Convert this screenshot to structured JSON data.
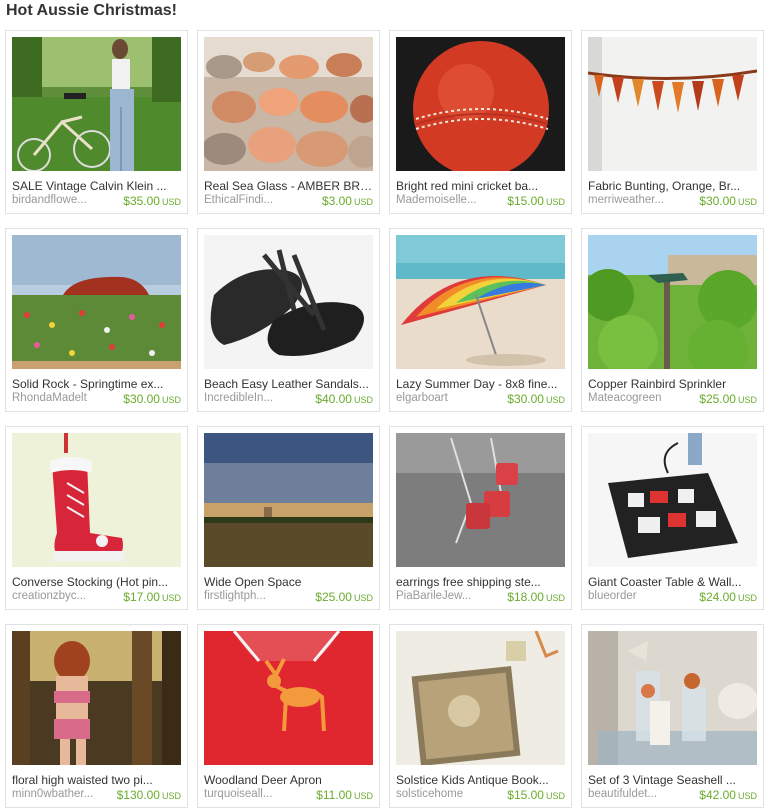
{
  "page": {
    "title": "Hot Aussie Christmas!"
  },
  "items": [
    {
      "title": "SALE Vintage Calvin Klein ...",
      "shop": "birdandflowe...",
      "price": "$35.00",
      "currency": "USD",
      "image": "vintage-jeans-bicycle-photo"
    },
    {
      "title": "Real Sea Glass - AMBER BRO...",
      "shop": "EthicalFindi...",
      "price": "$3.00",
      "currency": "USD",
      "image": "sea-glass-photo"
    },
    {
      "title": "Bright red mini cricket ba...",
      "shop": "Mademoiselle...",
      "price": "$15.00",
      "currency": "USD",
      "image": "cricket-ball-photo"
    },
    {
      "title": "Fabric Bunting, Orange, Br...",
      "shop": "merriweather...",
      "price": "$30.00",
      "currency": "USD",
      "image": "bunting-photo"
    },
    {
      "title": "Solid Rock - Springtime ex...",
      "shop": "RhondaMadelt",
      "price": "$30.00",
      "currency": "USD",
      "image": "uluru-painting"
    },
    {
      "title": "Beach Easy Leather Sandals...",
      "shop": "IncredibleIn...",
      "price": "$40.00",
      "currency": "USD",
      "image": "sandals-photo"
    },
    {
      "title": "Lazy Summer Day - 8x8 fine...",
      "shop": "elgarboart",
      "price": "$30.00",
      "currency": "USD",
      "image": "beach-umbrella-photo"
    },
    {
      "title": "Copper Rainbird Sprinkler",
      "shop": "Mateacogreen",
      "price": "$25.00",
      "currency": "USD",
      "image": "sprinkler-photo"
    },
    {
      "title": "Converse Stocking (Hot pin...",
      "shop": "creationzbyc...",
      "price": "$17.00",
      "currency": "USD",
      "image": "converse-stocking-photo"
    },
    {
      "title": "Wide Open Space",
      "shop": "firstlightph...",
      "price": "$25.00",
      "currency": "USD",
      "image": "landscape-photo"
    },
    {
      "title": "earrings free shipping ste...",
      "shop": "PiaBarileJew...",
      "price": "$18.00",
      "currency": "USD",
      "image": "earrings-photo"
    },
    {
      "title": "Giant Coaster Table & Wall...",
      "shop": "blueorder",
      "price": "$24.00",
      "currency": "USD",
      "image": "coaster-photo"
    },
    {
      "title": "floral high waisted two pi...",
      "shop": "minn0wbather...",
      "price": "$130.00",
      "currency": "USD",
      "image": "swimsuit-photo"
    },
    {
      "title": "Woodland Deer Apron",
      "shop": "turquoiseall...",
      "price": "$11.00",
      "currency": "USD",
      "image": "deer-apron-photo"
    },
    {
      "title": "Solstice Kids Antique Book...",
      "shop": "solsticehome",
      "price": "$15.00",
      "currency": "USD",
      "image": "antique-book-photo"
    },
    {
      "title": "Set of 3 Vintage Seashell ...",
      "shop": "beautifuldet...",
      "price": "$42.00",
      "currency": "USD",
      "image": "seashell-bottles-photo"
    }
  ]
}
